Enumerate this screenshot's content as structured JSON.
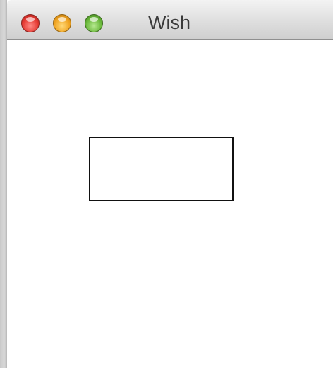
{
  "window": {
    "title": "Wish"
  },
  "titlebar": {
    "buttons": [
      {
        "name": "close-button",
        "color": "#e53a33"
      },
      {
        "name": "minimize-button",
        "color": "#f0a422"
      },
      {
        "name": "zoom-button",
        "color": "#6ab83b"
      }
    ]
  }
}
